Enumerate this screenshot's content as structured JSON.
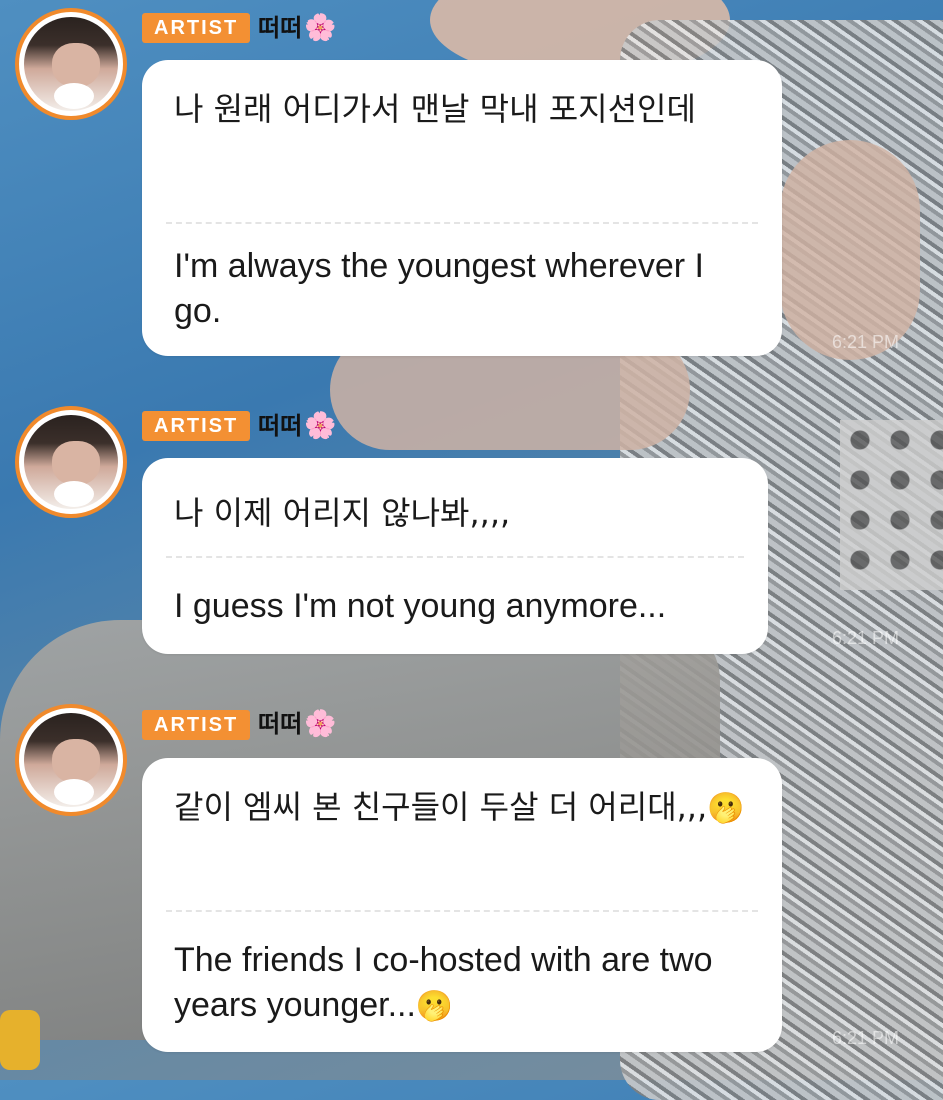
{
  "messages": [
    {
      "badge": "ARTIST",
      "name": "떠떠",
      "name_emoji": "🌸",
      "korean": "나 원래 어디가서 맨날 막내 포지션인데",
      "english": "I'm always the youngest wherever I go.",
      "time": "6:21 PM",
      "emoji": ""
    },
    {
      "badge": "ARTIST",
      "name": "떠떠",
      "name_emoji": "🌸",
      "korean": "나 이제 어리지 않나봐,,,,",
      "english": "I guess I'm not young anymore...",
      "time": "6:21 PM",
      "emoji": ""
    },
    {
      "badge": "ARTIST",
      "name": "떠떠",
      "name_emoji": "🌸",
      "korean": "같이 엠씨 본 친구들이 두살 더 어리대,,,",
      "english": "The friends I co-hosted with are two years younger...",
      "time": "6:21 PM",
      "emoji": "🫢"
    }
  ],
  "colors": {
    "badge": "#f39033",
    "avatar_ring": "#f08a2c",
    "bubble": "#ffffff"
  }
}
